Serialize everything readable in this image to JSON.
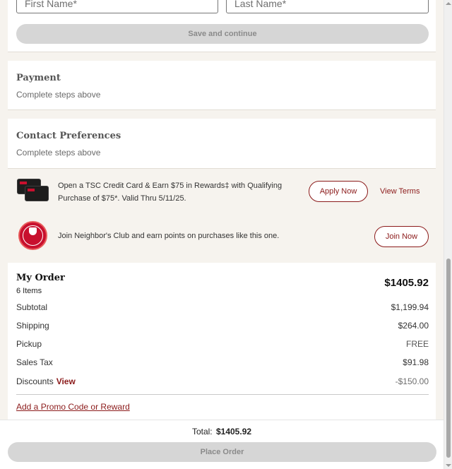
{
  "name_form": {
    "first_name_placeholder": "First Name*",
    "last_name_placeholder": "Last Name*",
    "save_label": "Save and continue"
  },
  "payment": {
    "title": "Payment",
    "status": "Complete steps above"
  },
  "contact": {
    "title": "Contact Preferences",
    "status": "Complete steps above"
  },
  "credit_promo": {
    "icon": "credit-cards-image",
    "text": "Open a TSC Credit Card & Earn $75 in Rewards‡ with Qualifying Purchase of $75*. Valid Thru 5/11/25.",
    "apply_label": "Apply Now",
    "terms_label": "View Terms"
  },
  "club_promo": {
    "icon": "neighbors-club-logo",
    "text": "Join Neighbor's Club and earn points on purchases like this one.",
    "join_label": "Join Now"
  },
  "order": {
    "title": "My Order",
    "item_count": "6 Items",
    "total": "$1405.92",
    "rows": [
      {
        "label": "Subtotal",
        "value": "$1,199.94"
      },
      {
        "label": "Shipping",
        "value": "$264.00"
      },
      {
        "label": "Pickup",
        "value": "FREE"
      },
      {
        "label": "Sales Tax",
        "value": "$91.98"
      },
      {
        "label": "Discounts",
        "value": "-$150.00"
      }
    ],
    "discounts_view_label": "View",
    "promo_link": "Add a Promo Code or Reward"
  },
  "footer": {
    "total_label": "Total:",
    "total_value": "$1405.92",
    "place_order_label": "Place Order"
  },
  "colors": {
    "accent": "#8b1a1a",
    "page_bg": "#f6f3ee",
    "disabled_button": "#d6d6d6"
  }
}
